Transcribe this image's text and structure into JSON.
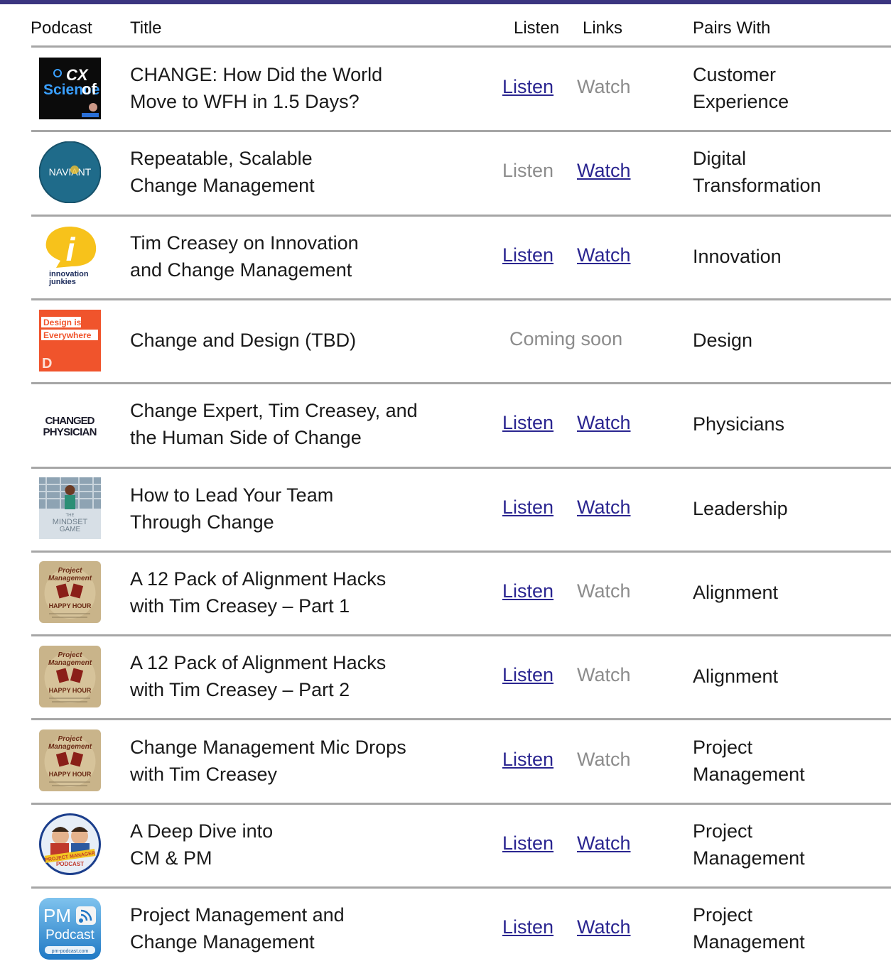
{
  "header": {
    "podcast": "Podcast",
    "title": "Title",
    "listen": "Listen",
    "links": "Links",
    "pairs_with": "Pairs With"
  },
  "colors": {
    "top_bar": "#3b3580",
    "link": "#2a2590",
    "disabled": "#8c8c8c",
    "divider": "#a6a6a6"
  },
  "rows": [
    {
      "logo": "science-of-cx-logo",
      "logo_text": [
        "CX",
        "Science",
        "of"
      ],
      "title": [
        "CHANGE: How Did the World",
        "Move to WFH in 1.5 Days?"
      ],
      "listen": "Listen",
      "watch": "Watch",
      "listen_active": true,
      "watch_active": false,
      "pairs": [
        "Customer",
        "Experience"
      ]
    },
    {
      "logo": "naviant-logo",
      "logo_text": [
        "NAVIANT"
      ],
      "title": [
        "Repeatable, Scalable",
        "Change Management"
      ],
      "listen": "Listen",
      "watch": "Watch",
      "listen_active": false,
      "watch_active": true,
      "pairs": [
        "Digital",
        "Transformation"
      ]
    },
    {
      "logo": "innovation-junkies-logo",
      "logo_text": [
        "innovation",
        "junkies"
      ],
      "title": [
        "Tim Creasey on Innovation",
        "and Change Management"
      ],
      "listen": "Listen",
      "watch": "Watch",
      "listen_active": true,
      "watch_active": true,
      "pairs": [
        "Innovation"
      ]
    },
    {
      "logo": "design-is-everywhere-logo",
      "logo_text": [
        "Design is",
        "Everywhere"
      ],
      "title": [
        "Change and Design (TBD)"
      ],
      "coming_soon": "Coming soon",
      "pairs": [
        "Design"
      ]
    },
    {
      "logo": "changed-physician-logo",
      "logo_text": [
        "CHANGED",
        "PHYSICIAN"
      ],
      "title": [
        "Change Expert, Tim Creasey, and",
        "the Human Side of Change"
      ],
      "listen": "Listen",
      "watch": "Watch",
      "listen_active": true,
      "watch_active": true,
      "pairs": [
        "Physicians"
      ]
    },
    {
      "logo": "mindset-game-logo",
      "logo_text": [
        "THE",
        "MINDSET",
        "GAME"
      ],
      "title": [
        "How to Lead Your Team",
        "Through Change"
      ],
      "listen": "Listen",
      "watch": "Watch",
      "listen_active": true,
      "watch_active": true,
      "pairs": [
        "Leadership"
      ]
    },
    {
      "logo": "pm-happy-hour-logo",
      "logo_text": [
        "Project",
        "Management",
        "HAPPY HOUR"
      ],
      "title": [
        "A 12 Pack  of Alignment Hacks",
        "with Tim Creasey – Part 1"
      ],
      "listen": "Listen",
      "watch": "Watch",
      "listen_active": true,
      "watch_active": false,
      "pairs": [
        "Alignment"
      ]
    },
    {
      "logo": "pm-happy-hour-logo",
      "logo_text": [
        "Project",
        "Management",
        "HAPPY HOUR"
      ],
      "title": [
        "A 12 Pack  of Alignment Hacks",
        "with Tim Creasey – Part 2"
      ],
      "listen": "Listen",
      "watch": "Watch",
      "listen_active": true,
      "watch_active": false,
      "pairs": [
        "Alignment"
      ]
    },
    {
      "logo": "pm-happy-hour-logo",
      "logo_text": [
        "Project",
        "Management",
        "HAPPY HOUR"
      ],
      "title": [
        "Change Management Mic Drops",
        "with Tim Creasey"
      ],
      "listen": "Listen",
      "watch": "Watch",
      "listen_active": true,
      "watch_active": false,
      "pairs": [
        "Project",
        "Management"
      ]
    },
    {
      "logo": "project-manager-podcast-logo",
      "logo_text": [
        "PROJECT MANAGER",
        "PODCAST"
      ],
      "title": [
        "A Deep Dive into",
        "CM & PM"
      ],
      "listen": "Listen",
      "watch": "Watch",
      "listen_active": true,
      "watch_active": true,
      "pairs": [
        "Project",
        "Management"
      ]
    },
    {
      "logo": "pm-podcast-logo",
      "logo_text": [
        "PM",
        "Podcast",
        "pm-podcast.com"
      ],
      "title": [
        "Project Management and",
        "Change Management"
      ],
      "listen": "Listen",
      "watch": "Watch",
      "listen_active": true,
      "watch_active": true,
      "pairs": [
        "Project",
        "Management"
      ]
    }
  ]
}
